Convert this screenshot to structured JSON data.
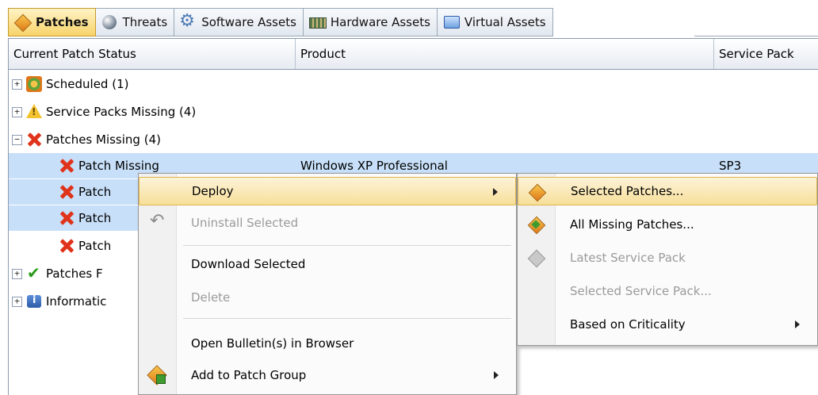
{
  "tabs": [
    {
      "label": "Patches",
      "icon": "patch-diamond-icon",
      "active": true
    },
    {
      "label": "Threats",
      "icon": "threat-globe-icon",
      "active": false
    },
    {
      "label": "Software Assets",
      "icon": "software-gear-icon",
      "active": false
    },
    {
      "label": "Hardware Assets",
      "icon": "hardware-board-icon",
      "active": false
    },
    {
      "label": "Virtual Assets",
      "icon": "virtual-machine-icon",
      "active": false
    }
  ],
  "columns": [
    "Current Patch Status",
    "Product",
    "Service Pack"
  ],
  "tree": [
    {
      "label": "Scheduled (1)",
      "expander": "+",
      "icon": "scheduled-icon"
    },
    {
      "label": "Service Packs Missing (4)",
      "expander": "+",
      "icon": "warning-icon"
    },
    {
      "label": "Patches Missing (4)",
      "expander": "−",
      "icon": "red-x-icon"
    },
    {
      "label": "Patch Missing",
      "product": "Windows XP Professional",
      "service_pack": "SP3",
      "icon": "red-x-icon",
      "selected": true
    },
    {
      "label": "Patch",
      "icon": "red-x-icon",
      "selected": true
    },
    {
      "label": "Patch",
      "icon": "red-x-icon",
      "selected": true
    },
    {
      "label": "Patch",
      "icon": "red-x-icon",
      "selected": false
    },
    {
      "label": "Patches F",
      "expander": "+",
      "icon": "green-check-icon"
    },
    {
      "label": "Informatic",
      "expander": "+",
      "icon": "information-icon"
    }
  ],
  "context_menu": {
    "items": [
      {
        "label": "Deploy",
        "submenu": true,
        "hot": true
      },
      {
        "label": "Uninstall Selected",
        "disabled": true,
        "icon": "uninstall-icon"
      },
      {
        "label": "Download Selected"
      },
      {
        "label": "Delete",
        "disabled": true
      },
      {
        "label": "Open Bulletin(s) in Browser"
      },
      {
        "label": "Add to Patch Group",
        "submenu": true,
        "icon": "patch-group-icon"
      }
    ]
  },
  "deploy_submenu": {
    "items": [
      {
        "label": "Selected Patches...",
        "hot": true,
        "icon": "deploy-patch-icon"
      },
      {
        "label": "All Missing Patches...",
        "icon": "deploy-all-icon"
      },
      {
        "label": "Latest Service Pack",
        "disabled": true,
        "icon": "service-pack-disabled-icon"
      },
      {
        "label": "Selected Service Pack...",
        "disabled": true
      },
      {
        "label": "Based on Criticality",
        "submenu": true
      }
    ]
  },
  "colors": {
    "selection": "#c7dff8",
    "menu_hot": "#f7df9a",
    "red_x": "#e0331b"
  }
}
